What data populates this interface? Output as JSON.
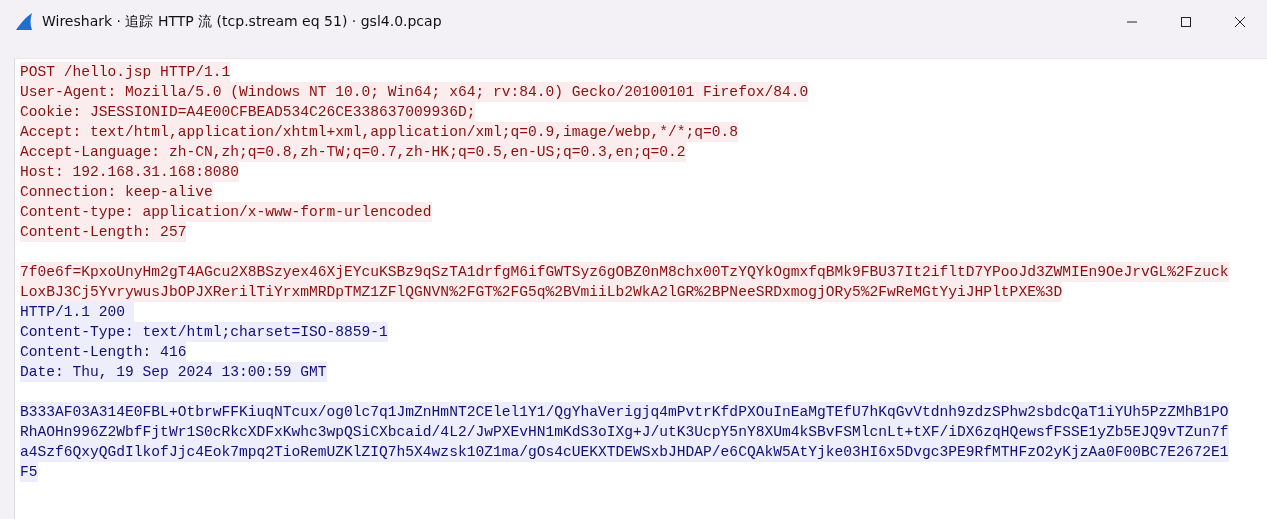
{
  "window": {
    "title": "Wireshark · 追踪 HTTP 流 (tcp.stream eq 51) · gsl4.0.pcap"
  },
  "stream": [
    {
      "kind": "client",
      "blank_line_after": true,
      "lines": [
        "POST /hello.jsp HTTP/1.1",
        "User-Agent: Mozilla/5.0 (Windows NT 10.0; Win64; x64; rv:84.0) Gecko/20100101 Firefox/84.0",
        "Cookie: JSESSIONID=A4E00CFBEAD534C26CE338637009936D;",
        "Accept: text/html,application/xhtml+xml,application/xml;q=0.9,image/webp,*/*;q=0.8",
        "Accept-Language: zh-CN,zh;q=0.8,zh-TW;q=0.7,zh-HK;q=0.5,en-US;q=0.3,en;q=0.2",
        "Host: 192.168.31.168:8080",
        "Connection: keep-alive",
        "Content-type: application/x-www-form-urlencoded",
        "Content-Length: 257"
      ]
    },
    {
      "kind": "client",
      "blank_line_after": false,
      "lines": [
        "7f0e6f=KpxoUnyHm2gT4AGcu2X8BSzyex46XjEYcuKSBz9qSzTA1drfgM6ifGWTSyz6gOBZ0nM8chx00TzYQYkOgmxfqBMk9FBU37It2ifltD7YPooJd3ZWMIEn9OeJrvGL%2Fzuck",
        "LoxBJ3Cj5YvrywusJbOPJXRerilTiYrxmMRDpTMZ1ZFlQGNVN%2FGT%2FG5q%2BVmiiLb2WkA2lGR%2BPNeeSRDxmogjORy5%2FwReMGtYyiJHPltPXE%3D"
      ]
    },
    {
      "kind": "server",
      "blank_line_after": true,
      "lines": [
        "HTTP/1.1 200 ",
        "Content-Type: text/html;charset=ISO-8859-1",
        "Content-Length: 416",
        "Date: Thu, 19 Sep 2024 13:00:59 GMT"
      ]
    },
    {
      "kind": "server",
      "blank_line_after": false,
      "lines": [
        "B333AF03A314E0FBL+OtbrwFFKiuqNTcux/og0lc7q1JmZnHmNT2CElel1Y1/QgYhaVerigjq4mPvtrKfdPXOuInEaMgTEfU7hKqGvVtdnh9zdzSPhw2sbdcQaT1iYUh5PzZMhB1PO",
        "RhAOHn996Z2WbfFjtWr1S0cRkcXDFxKwhc3wpQSiCXbcaid/4L2/JwPXEvHN1mKdS3oIXg+J/utK3UcpY5nY8XUm4kSBvFSMlcnLt+tXF/iDX6zqHQewsfFSSE1yZb5EJQ9vTZun7f",
        "a4Szf6QxyQGdIlkofJjc4Eok7mpq2TioRemUZKlZIQ7h5X4wzsk10Z1ma/gOs4cUEKXTDEWSxbJHDAP/e6CQAkW5AtYjke03HI6x5Dvgc3PE9RfMTHFzO2yKjzAa0F00BC7E2672E1",
        "F5"
      ]
    }
  ]
}
